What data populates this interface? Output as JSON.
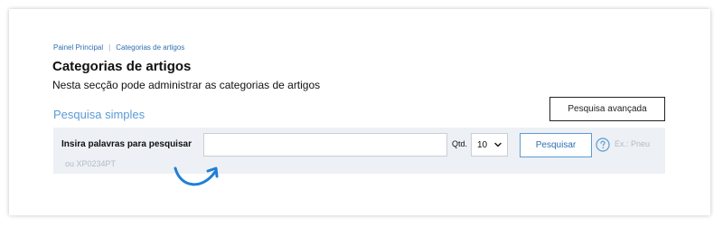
{
  "breadcrumb": {
    "items": [
      "Painel Principal",
      "Categorias de artigos"
    ],
    "separator": "|"
  },
  "page": {
    "title": "Categorias de artigos",
    "subtitle": "Nesta secção pode administrar as categorias de artigos"
  },
  "advanced_search": {
    "label": "Pesquisa avançada"
  },
  "simple_search": {
    "title": "Pesquisa simples",
    "label": "Insira palavras para pesquisar",
    "input_value": "",
    "qtd_label": "Qtd.",
    "qtd_value": "10",
    "button_label": "Pesquisar",
    "hint_line1": "Ex.: Pneu",
    "hint_line2": "ou XP0234PT"
  },
  "icons": {
    "help": "question-circle-icon",
    "dropdown": "chevron-down-icon",
    "annotation": "curved-arrow-icon"
  },
  "colors": {
    "accent": "#5b9bd5",
    "link": "#2d6fb0",
    "arrow": "#1f7fd6",
    "bar_bg": "#edf0f5"
  }
}
